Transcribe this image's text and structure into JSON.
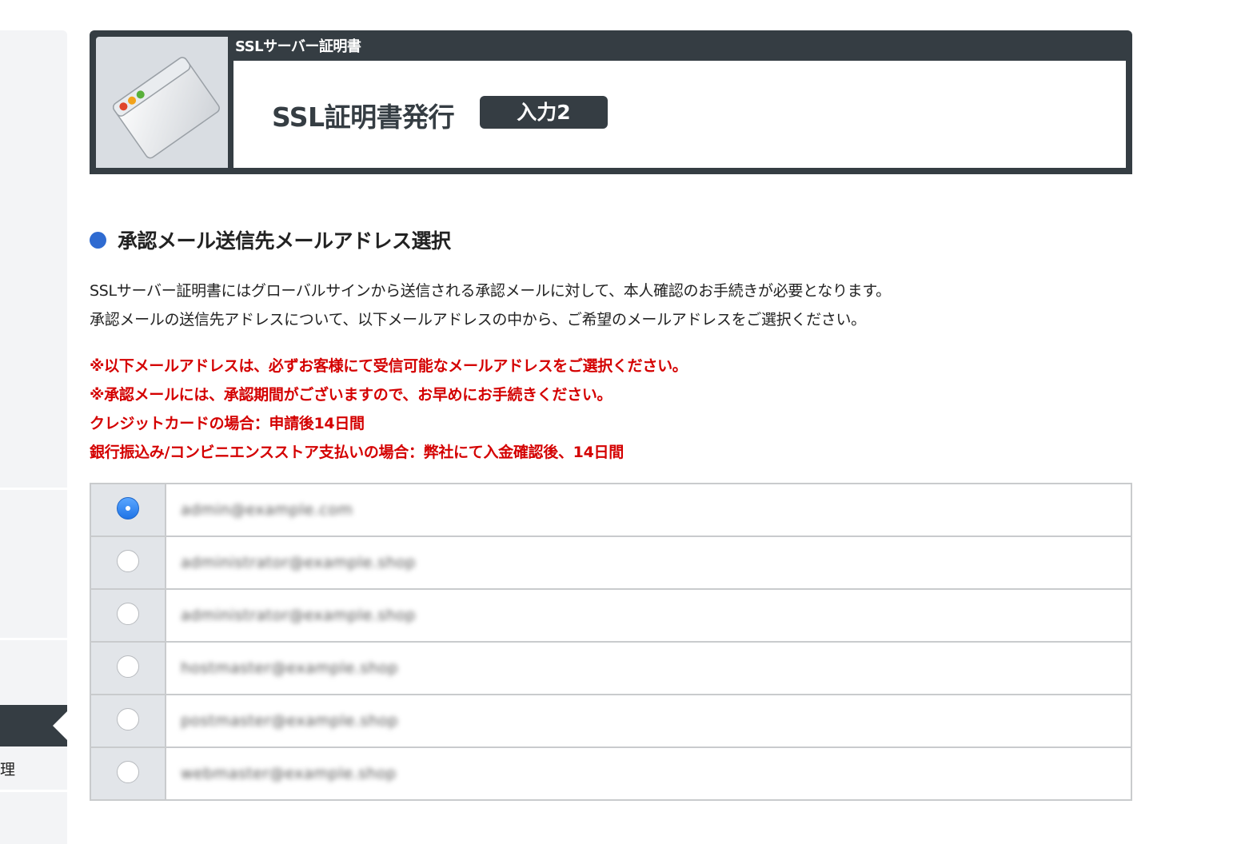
{
  "sidebar": {
    "partial_label": "理"
  },
  "header": {
    "section_label": "SSLサーバー証明書",
    "page_title": "SSL証明書発行",
    "step_badge": "入力2"
  },
  "section": {
    "heading": "承認メール送信先メールアドレス選択",
    "description": [
      "SSLサーバー証明書にはグローバルサインから送信される承認メールに対して、本人確認のお手続きが必要となります。",
      "承認メールの送信先アドレスについて、以下メールアドレスの中から、ご希望のメールアドレスをご選択ください。"
    ],
    "notes": [
      "※以下メールアドレスは、必ずお客様にて受信可能なメールアドレスをご選択ください。",
      "※承認メールには、承認期間がございますので、お早めにお手続きください。",
      "クレジットカードの場合：申請後14日間",
      "銀行振込み/コンビニエンスストア支払いの場合：弊社にて入金確認後、14日間"
    ],
    "note_color": "#d40000"
  },
  "address_options": [
    {
      "value": "admin@example.com",
      "selected": true
    },
    {
      "value": "administrator@example.shop",
      "selected": false
    },
    {
      "value": "administrator@example.shop",
      "selected": false
    },
    {
      "value": "hostmaster@example.shop",
      "selected": false
    },
    {
      "value": "postmaster@example.shop",
      "selected": false
    },
    {
      "value": "webmaster@example.shop",
      "selected": false
    }
  ],
  "colors": {
    "header_bg": "#353d43",
    "accent_blue": "#2f6bd1",
    "radio_cell_bg": "#e2e5e9"
  }
}
